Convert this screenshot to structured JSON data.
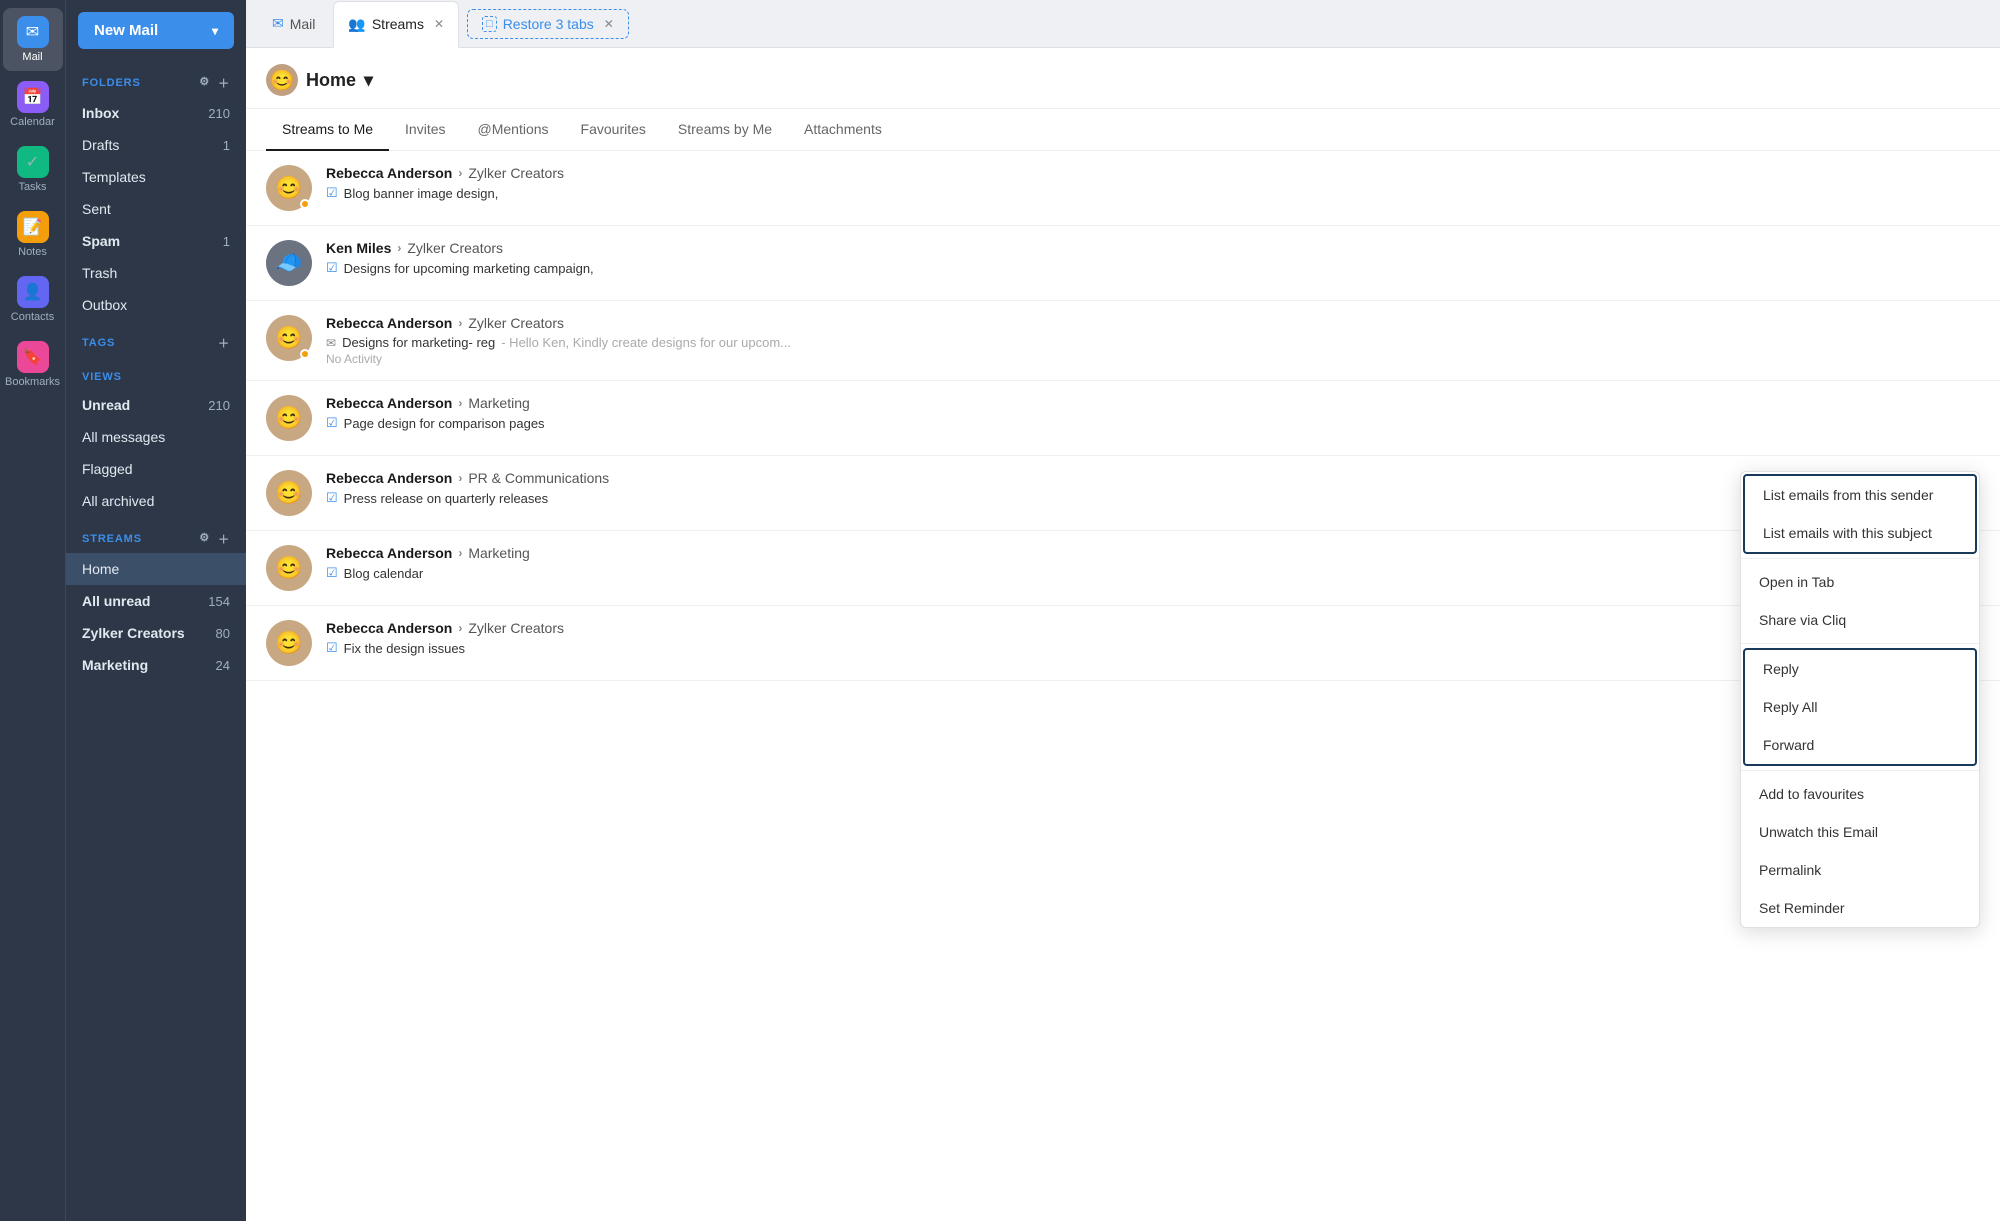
{
  "sidebar": {
    "new_mail_label": "New Mail",
    "app_icons": [
      {
        "id": "mail",
        "label": "Mail",
        "icon": "✉",
        "active": true
      },
      {
        "id": "calendar",
        "label": "Calendar",
        "icon": "📅",
        "active": false
      },
      {
        "id": "tasks",
        "label": "Tasks",
        "icon": "✓",
        "active": false
      },
      {
        "id": "notes",
        "label": "Notes",
        "icon": "📝",
        "active": false
      },
      {
        "id": "contacts",
        "label": "Contacts",
        "icon": "👤",
        "active": false
      },
      {
        "id": "bookmarks",
        "label": "Bookmarks",
        "icon": "🔖",
        "active": false
      }
    ],
    "folders_label": "FOLDERS",
    "folders": [
      {
        "label": "Inbox",
        "count": "210",
        "bold": true
      },
      {
        "label": "Drafts",
        "count": "1",
        "bold": false
      },
      {
        "label": "Templates",
        "count": "",
        "bold": false
      },
      {
        "label": "Sent",
        "count": "",
        "bold": false
      },
      {
        "label": "Spam",
        "count": "1",
        "bold": true
      },
      {
        "label": "Trash",
        "count": "",
        "bold": false
      },
      {
        "label": "Outbox",
        "count": "",
        "bold": false
      }
    ],
    "tags_label": "TAGS",
    "views_label": "VIEWS",
    "views": [
      {
        "label": "Unread",
        "count": "210"
      },
      {
        "label": "All messages",
        "count": ""
      },
      {
        "label": "Flagged",
        "count": ""
      },
      {
        "label": "All archived",
        "count": ""
      }
    ],
    "streams_label": "STREAMS",
    "streams": [
      {
        "label": "Home",
        "count": "",
        "active": true
      },
      {
        "label": "All unread",
        "count": "154",
        "bold": true
      },
      {
        "label": "Zylker Creators",
        "count": "80",
        "bold": true
      },
      {
        "label": "Marketing",
        "count": "24",
        "bold": true
      }
    ]
  },
  "tabs": [
    {
      "label": "Mail",
      "icon": "✉",
      "active": false,
      "closeable": false
    },
    {
      "label": "Streams",
      "icon": "👥",
      "active": true,
      "closeable": true
    }
  ],
  "restore_tabs": {
    "label": "Restore 3 tabs"
  },
  "header": {
    "title": "Home",
    "dropdown_icon": "▾"
  },
  "streams_tabs": [
    {
      "label": "Streams to Me",
      "active": true
    },
    {
      "label": "Invites",
      "active": false
    },
    {
      "label": "@Mentions",
      "active": false
    },
    {
      "label": "Favourites",
      "active": false
    },
    {
      "label": "Streams by Me",
      "active": false
    },
    {
      "label": "Attachments",
      "active": false
    }
  ],
  "emails": [
    {
      "sender": "Rebecca Anderson",
      "channel": "Zylker Creators",
      "subject": "Blog banner image design,",
      "preview": "",
      "has_dot": true,
      "avatar_emoji": "😊"
    },
    {
      "sender": "Ken Miles",
      "channel": "Zylker Creators",
      "subject": "Designs for upcoming marketing campaign,",
      "preview": "",
      "has_dot": false,
      "avatar_emoji": "🧢"
    },
    {
      "sender": "Rebecca Anderson",
      "channel": "Zylker Creators",
      "subject": "Designs for marketing- reg",
      "preview": "Hello Ken, Kindly create designs for our upcom...",
      "no_activity": "No Activity",
      "has_dot": true,
      "avatar_emoji": "😊"
    },
    {
      "sender": "Rebecca Anderson",
      "channel": "Marketing",
      "subject": "Page design for comparison pages",
      "preview": "",
      "has_dot": false,
      "avatar_emoji": "😊"
    },
    {
      "sender": "Rebecca Anderson",
      "channel": "PR & Communications",
      "subject": "Press release on quarterly releases",
      "preview": "",
      "has_dot": false,
      "avatar_emoji": "😊"
    },
    {
      "sender": "Rebecca Anderson",
      "channel": "Marketing",
      "subject": "Blog calendar",
      "preview": "",
      "has_dot": false,
      "avatar_emoji": "😊"
    },
    {
      "sender": "Rebecca Anderson",
      "channel": "Zylker Creators",
      "subject": "Fix the design issues",
      "preview": "",
      "has_dot": false,
      "avatar_emoji": "😊"
    }
  ],
  "context_menu": {
    "items_group1": [
      {
        "label": "List emails from this sender",
        "grouped": true
      },
      {
        "label": "List emails with this subject",
        "grouped": true
      }
    ],
    "items_group2": [
      {
        "label": "Open in Tab"
      },
      {
        "label": "Share via Cliq"
      }
    ],
    "items_group3": [
      {
        "label": "Reply",
        "grouped": true
      },
      {
        "label": "Reply All",
        "grouped": true
      },
      {
        "label": "Forward",
        "grouped": true
      }
    ],
    "items_group4": [
      {
        "label": "Add to favourites"
      },
      {
        "label": "Unwatch this Email"
      },
      {
        "label": "Permalink"
      },
      {
        "label": "Set Reminder"
      }
    ]
  }
}
